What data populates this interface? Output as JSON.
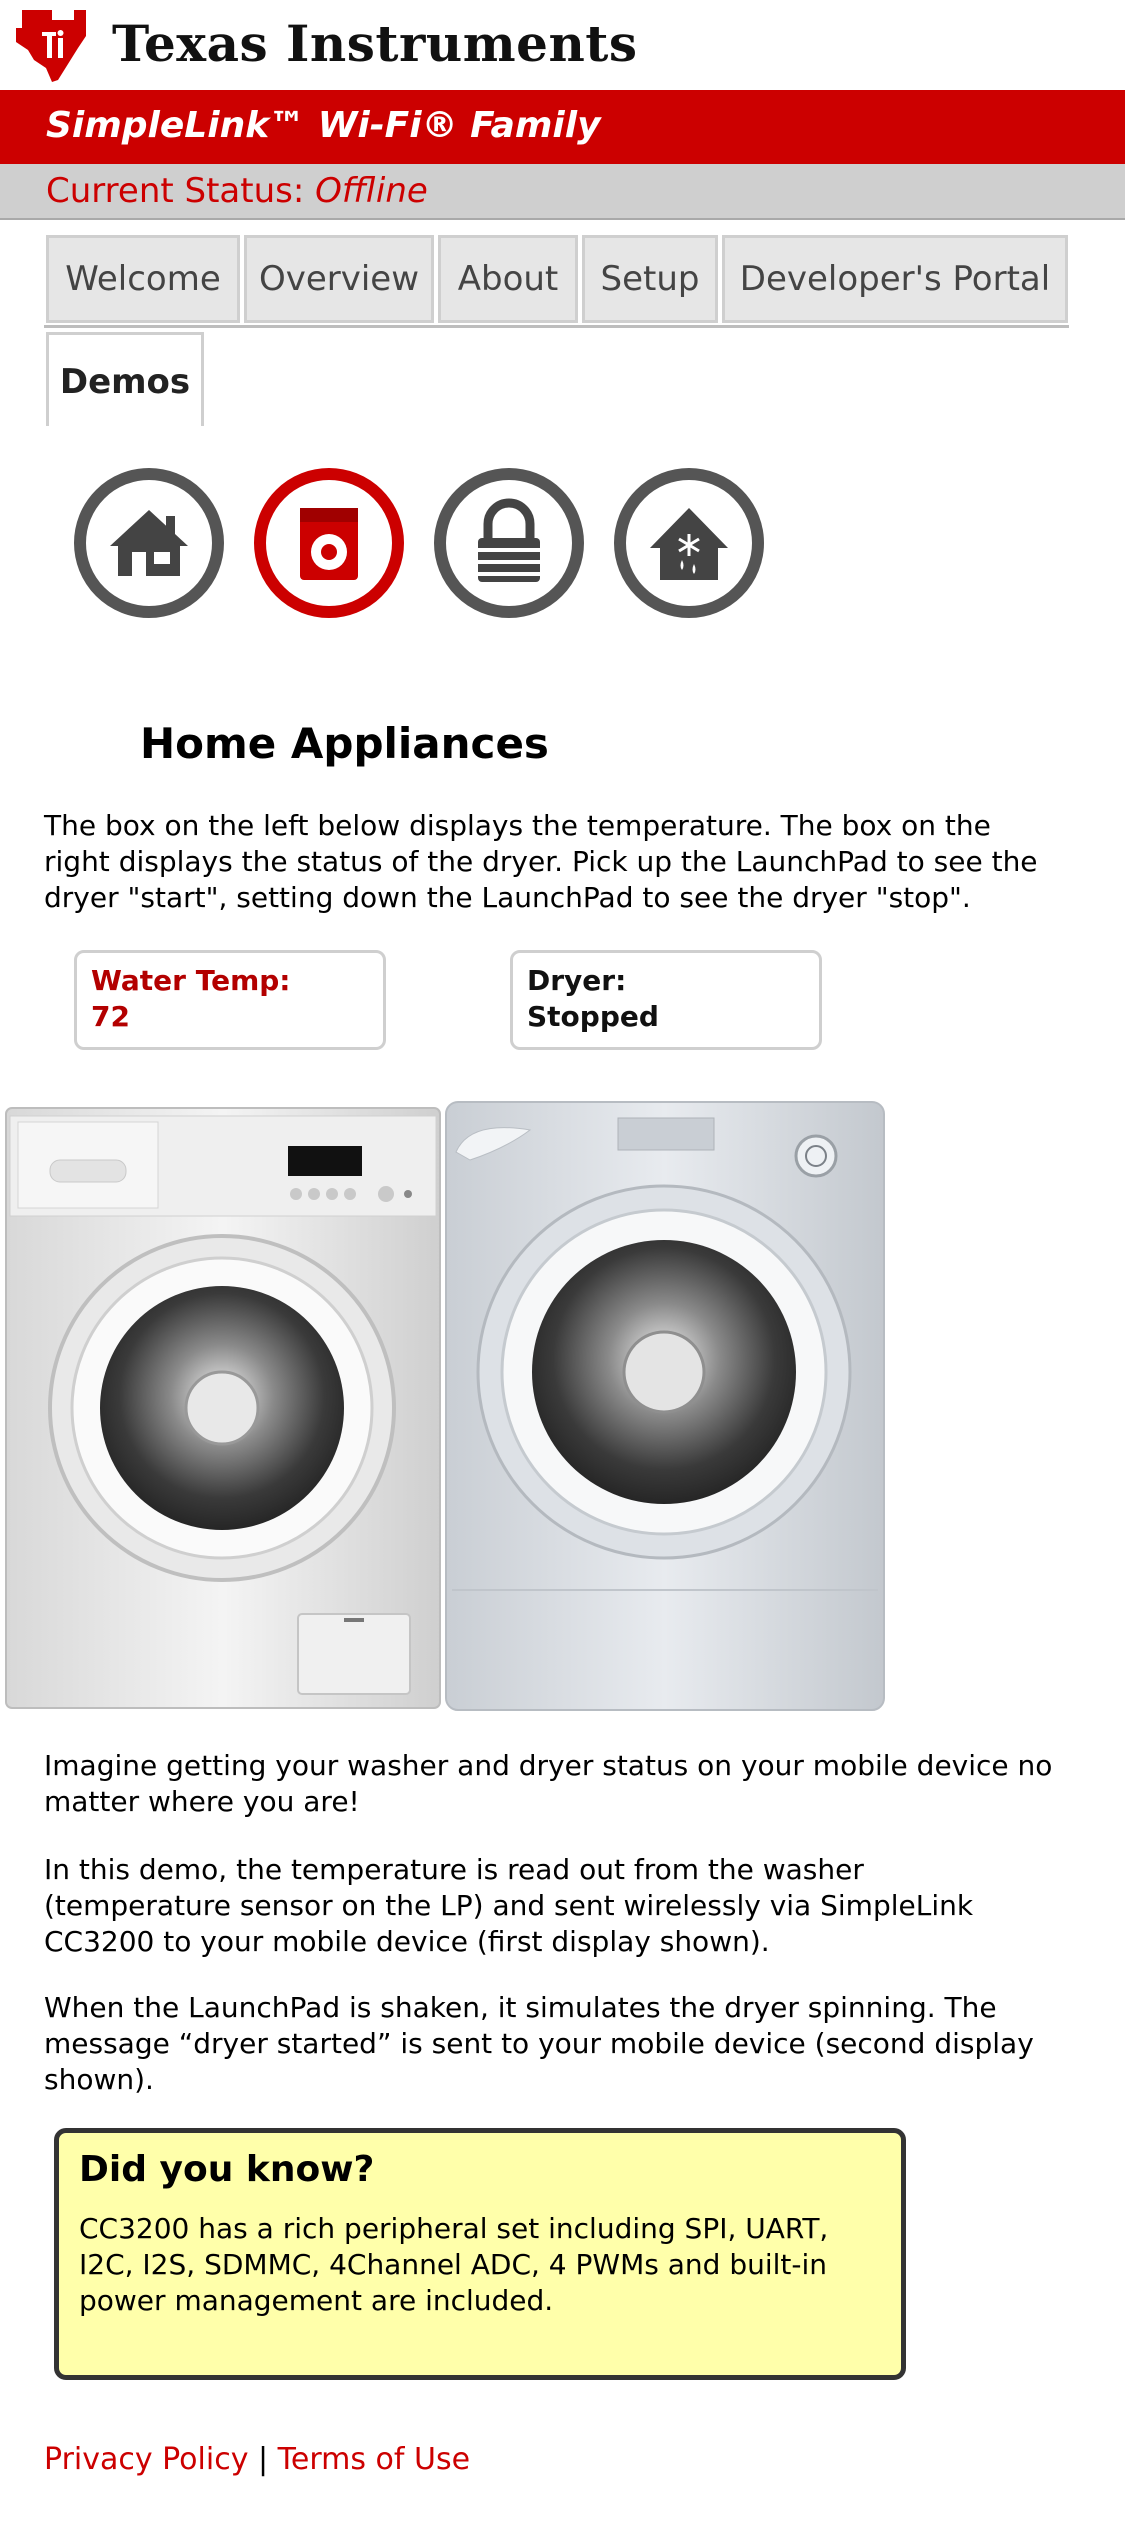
{
  "header": {
    "brand": "Texas Instruments",
    "banner": "SimpleLink™ Wi-Fi® Family",
    "status_label": "Current Status:",
    "status_value": "Offline"
  },
  "tabs": [
    {
      "label": "Welcome"
    },
    {
      "label": "Overview"
    },
    {
      "label": "About"
    },
    {
      "label": "Setup"
    },
    {
      "label": "Developer's Portal"
    },
    {
      "label": "Demos",
      "active": true
    }
  ],
  "demo_icons": [
    {
      "icon": "home-icon",
      "color": "#555555"
    },
    {
      "icon": "washer-icon",
      "color": "#cc0000"
    },
    {
      "icon": "lock-icon",
      "color": "#555555"
    },
    {
      "icon": "thermostat-house-icon",
      "color": "#555555"
    }
  ],
  "main": {
    "title": "Home Appliances",
    "description": "The box on the left below displays the temperature. The box on the right displays the status of the dryer. Pick up the LaunchPad to see the dryer \"start\", setting down the LaunchPad to see the dryer \"stop\".",
    "temp_label": "Water Temp:",
    "temp_value": "72",
    "dryer_label": "Dryer:",
    "dryer_value": "Stopped",
    "para1": "Imagine getting your washer and dryer status on your mobile device no matter where you are!",
    "para2": "In this demo, the temperature is read out from the washer (temperature sensor on the LP) and sent wirelessly  via SimpleLink CC3200 to your mobile device (first display shown).",
    "para3": "When the LaunchPad is shaken, it simulates the dryer spinning. The message “dryer started” is sent to your mobile device (second display shown)."
  },
  "did_you_know": {
    "title": "Did you know?",
    "text": "CC3200 has a rich peripheral set including SPI, UART, I2C, I2S, SDMMC, 4Channel ADC, 4 PWMs and built-in power management are included."
  },
  "footer": {
    "privacy": "Privacy Policy",
    "separator": "|",
    "terms": "Terms of Use"
  },
  "colors": {
    "brand_red": "#cc0000",
    "status_bg": "#cfcfcf",
    "note_bg": "#ffffaa"
  }
}
